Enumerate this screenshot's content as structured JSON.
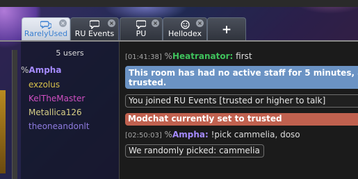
{
  "tabs": [
    {
      "label": "RarelyUsed",
      "icon": "chat-bubbles-icon"
    },
    {
      "label": "RU Events",
      "icon": "chat-bubble-icon"
    },
    {
      "label": "PU",
      "icon": "chat-bubble-icon"
    },
    {
      "label": "Hellodex",
      "icon": "smiley-icon"
    },
    {
      "label": "+",
      "icon": "plus-icon"
    }
  ],
  "close_glyph": "×",
  "userlist": {
    "count_label": "5 users",
    "users": [
      {
        "rank": "%",
        "name": "Ampha",
        "color": "#a58bff"
      },
      {
        "rank": "",
        "name": "exzolus",
        "color": "#d9c24b"
      },
      {
        "rank": "",
        "name": "KelTheMaster",
        "color": "#d04fc2"
      },
      {
        "rank": "",
        "name": "Metallica126",
        "color": "#d7cf86"
      },
      {
        "rank": "",
        "name": "theoneandonlt",
        "color": "#8f7ce0"
      }
    ]
  },
  "chat": {
    "messages": [
      {
        "time": "[01:41:38]",
        "rank": "%",
        "user": "Heatranator:",
        "user_color": "#3fc25c",
        "text": "first"
      },
      {
        "time": "[02:50:03]",
        "rank": "%",
        "user": "Ampha:",
        "user_color": "#a58bff",
        "text": "!pick cammelia, doso"
      }
    ],
    "notices": {
      "inactive_staff_line1": "This room has had no active staff for 5 minutes, a",
      "inactive_staff_line2": "trusted.",
      "joined": "You joined RU Events [trusted or higher to talk]",
      "modchat": "Modchat currently set to trusted",
      "picked": "We randomly picked:  cammelia"
    }
  }
}
